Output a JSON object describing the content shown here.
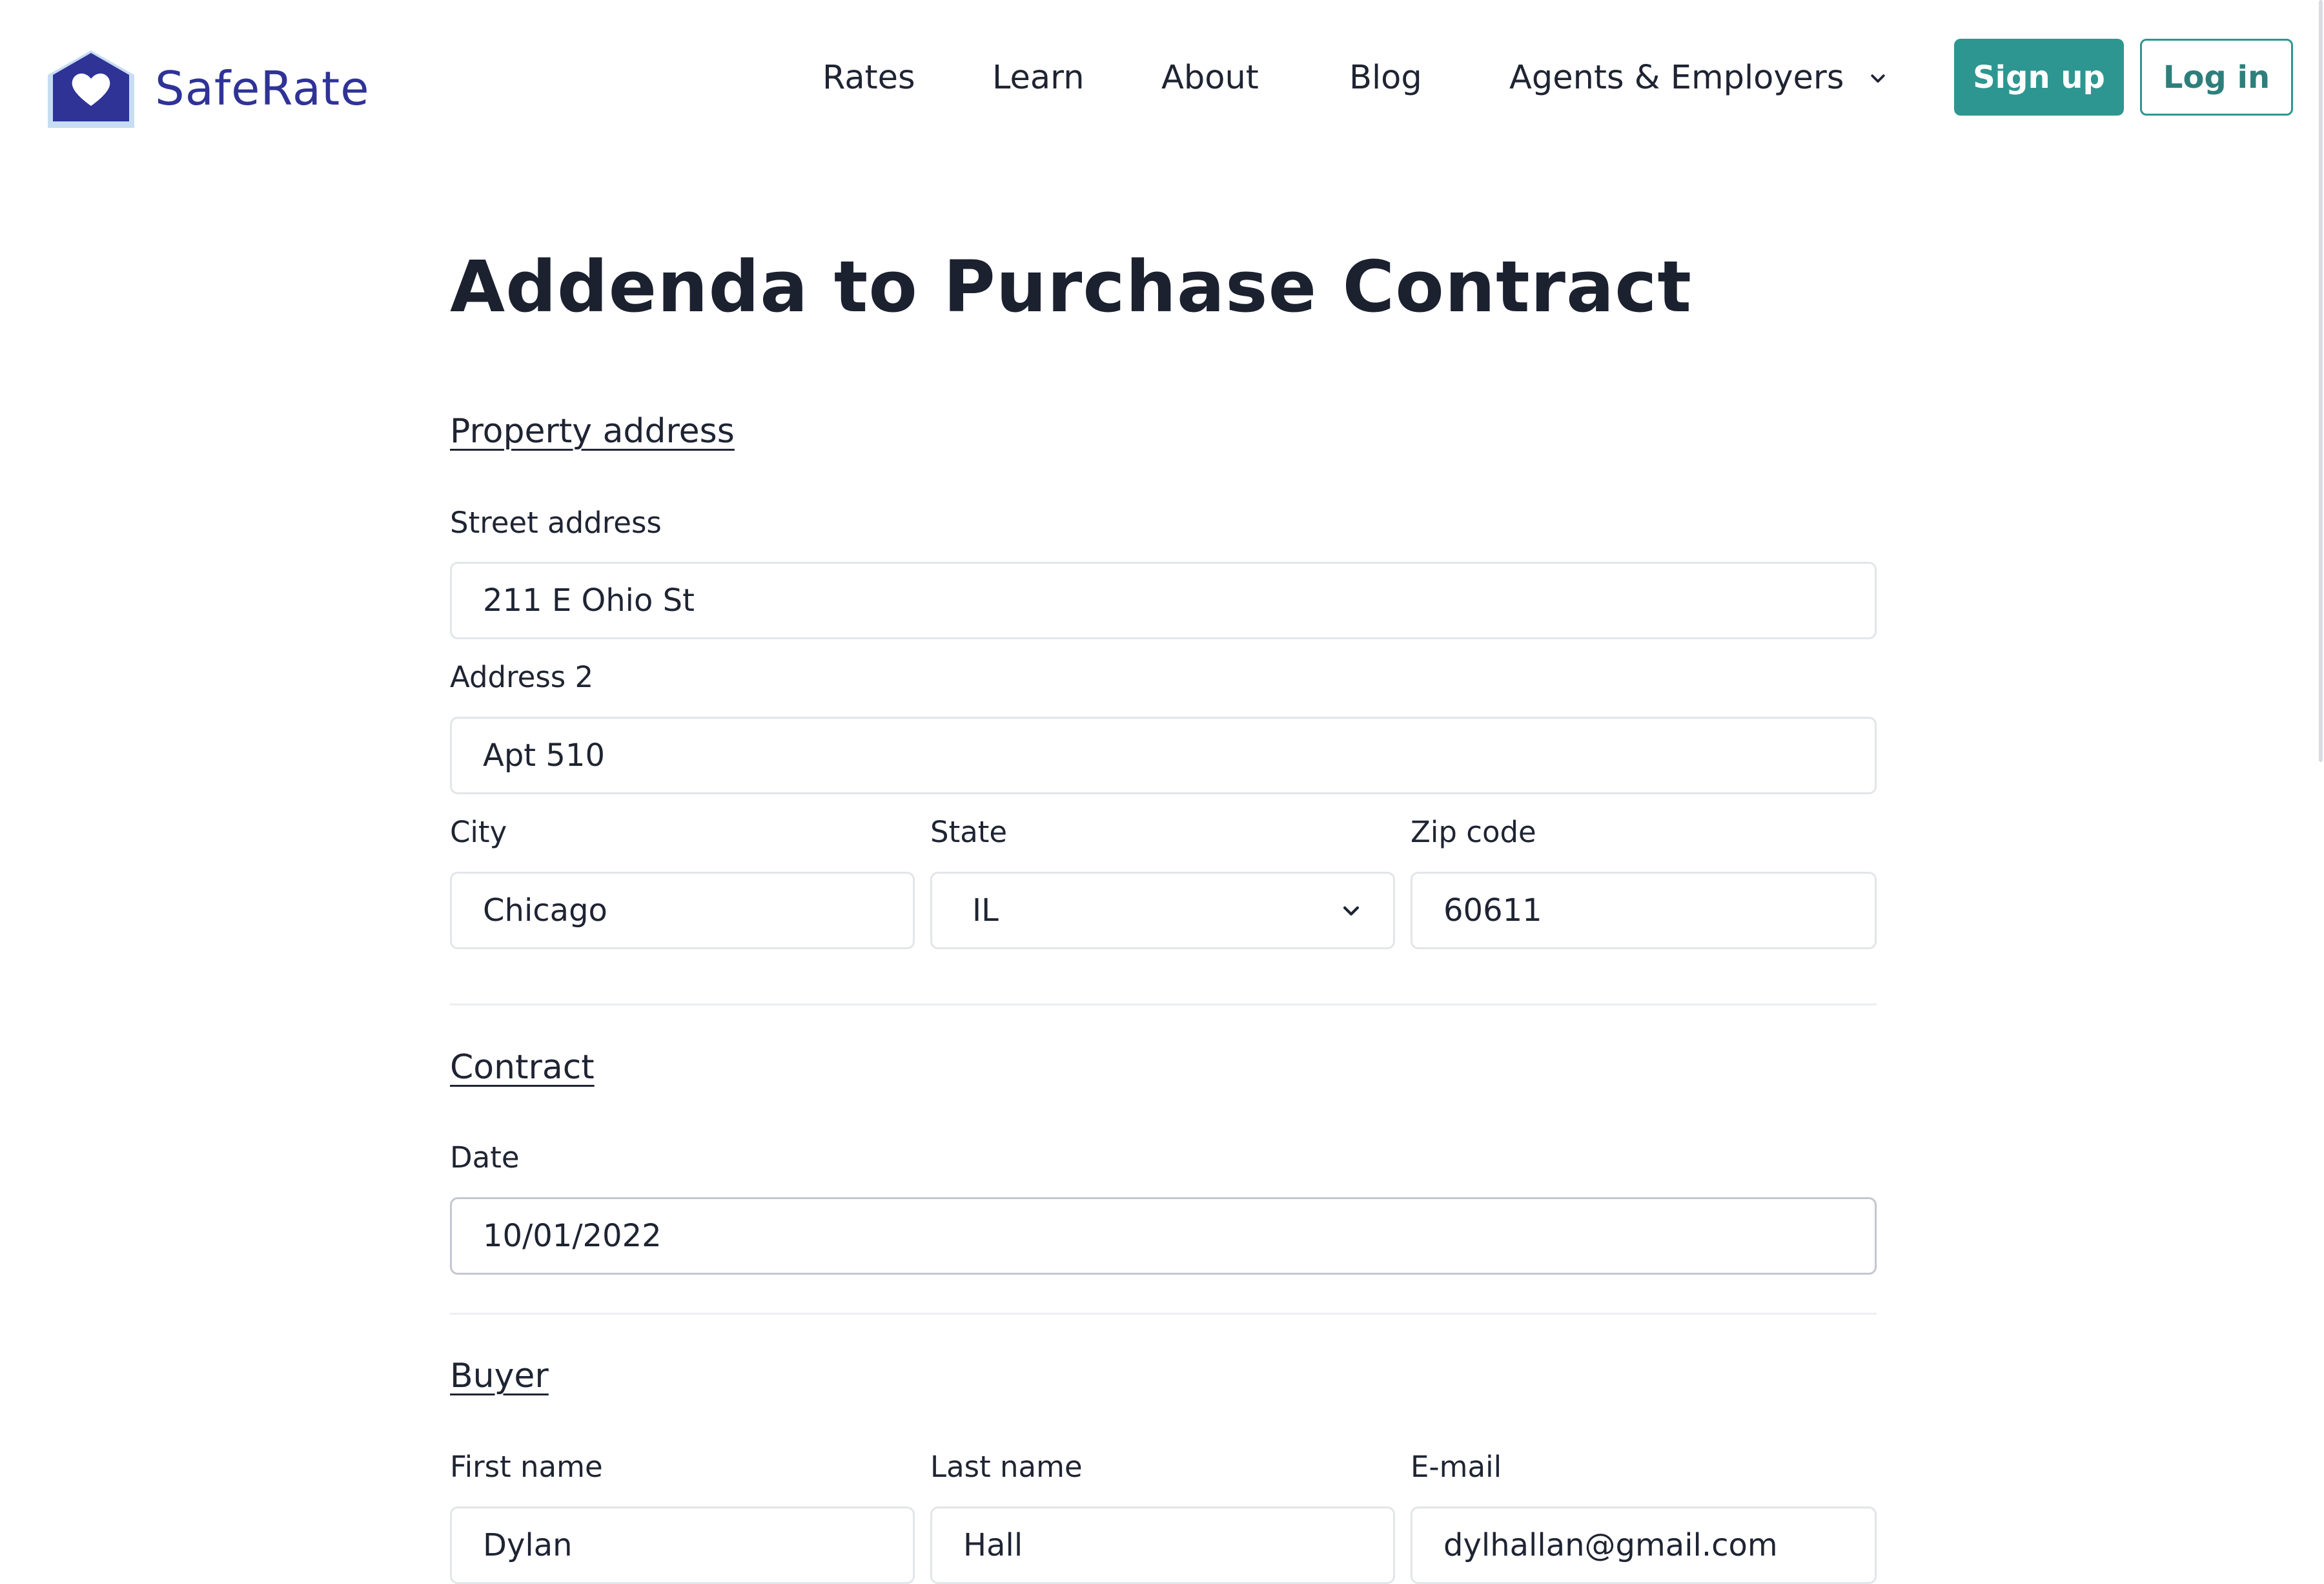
{
  "brand": {
    "name": "SafeRate",
    "logo_icon": "house-heart-icon"
  },
  "nav": {
    "rates": "Rates",
    "learn": "Learn",
    "about": "About",
    "blog": "Blog",
    "agents": "Agents & Employers"
  },
  "auth": {
    "signup": "Sign up",
    "login": "Log in"
  },
  "page": {
    "title": "Addenda to Purchase Contract"
  },
  "property": {
    "section": "Property address",
    "street_label": "Street address",
    "street_value": "211 E Ohio St",
    "address2_label": "Address 2",
    "address2_value": "Apt 510",
    "city_label": "City",
    "city_value": "Chicago",
    "state_label": "State",
    "state_value": "IL",
    "zip_label": "Zip code",
    "zip_value": "60611"
  },
  "contract": {
    "section": "Contract",
    "date_label": "Date",
    "date_value": "10/01/2022"
  },
  "buyer": {
    "section": "Buyer",
    "first_label": "First name",
    "first_value": "Dylan",
    "last_label": "Last name",
    "last_value": "Hall",
    "email_label": "E-mail",
    "email_value": "dylhallan@gmail.com"
  },
  "colors": {
    "brand": "#2f3396",
    "accent": "#2e9690",
    "text": "#1f2433",
    "border": "#e2e5ea"
  }
}
